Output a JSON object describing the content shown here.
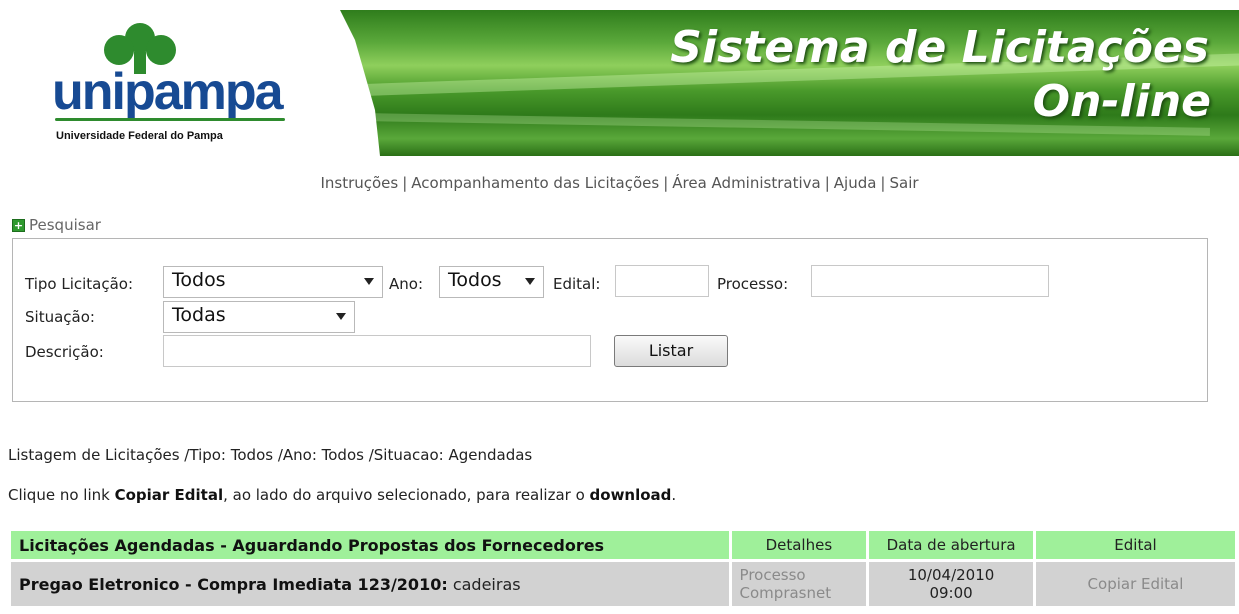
{
  "header": {
    "logo_name": "unipampa",
    "logo_subtitle": "Universidade Federal do Pampa",
    "title_line1": "Sistema de Licitações",
    "title_line2": "On-line"
  },
  "nav": {
    "items": [
      "Instruções",
      "Acompanhamento das Licitações",
      "Área Administrativa",
      "Ajuda",
      "Sair"
    ],
    "separator": "|"
  },
  "search": {
    "toggle_label": "Pesquisar",
    "tipo_label": "Tipo Licitação:",
    "tipo_value": "Todos",
    "ano_label": "Ano:",
    "ano_value": "Todos",
    "edital_label": "Edital:",
    "edital_value": "",
    "processo_label": "Processo:",
    "processo_value": "",
    "situacao_label": "Situação:",
    "situacao_value": "Todas",
    "descricao_label": "Descrição:",
    "descricao_value": "",
    "listar_label": "Listar"
  },
  "listing": {
    "summary": "Listagem de Licitações /Tipo: Todos /Ano: Todos /Situacao: Agendadas",
    "instr_prefix": "Clique no link ",
    "instr_link": "Copiar Edital",
    "instr_mid": ", ao lado do arquivo selecionado, para realizar o ",
    "instr_download": "download",
    "instr_end": "."
  },
  "table": {
    "headers": [
      "Licitações Agendadas - Aguardando Propostas dos Fornecedores",
      "Detalhes",
      "Data de abertura",
      "Edital"
    ],
    "rows": [
      {
        "title": "Pregao Eletronico - Compra Imediata 123/2010:",
        "desc": " cadeiras",
        "detalhes_line1": "Processo",
        "detalhes_line2": "Comprasnet",
        "date": "10/04/2010",
        "time": "09:00",
        "edital": "Copiar Edital"
      }
    ]
  },
  "colors": {
    "header_green": "#9ff09a",
    "row_gray": "#d2d2d2",
    "logo_blue": "#174a93"
  }
}
